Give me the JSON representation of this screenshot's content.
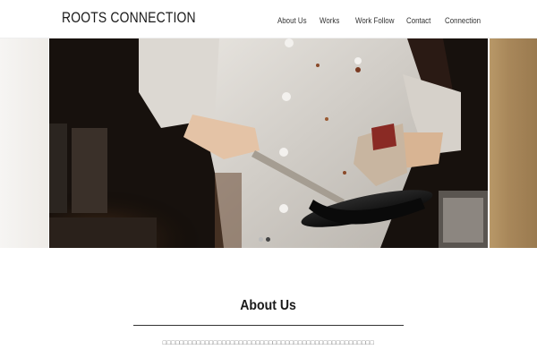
{
  "header": {
    "logo": "ROOTS CONNECTION",
    "nav": [
      {
        "label": "About Us"
      },
      {
        "label": "Works"
      },
      {
        "label": "Work Follow"
      },
      {
        "label": "Contact"
      },
      {
        "label": "Connection"
      }
    ]
  },
  "hero": {
    "slide_count": 2,
    "active_slide": 2
  },
  "about": {
    "title": "About Us",
    "text": "□□□□□□□□□□□□□□□□□□□□□□□□□□□□□□□□□□□□□□□□□□□□□□□□□□"
  },
  "colors": {
    "background": "#ffffff",
    "text": "#1a1a1a",
    "rule": "#333333"
  }
}
